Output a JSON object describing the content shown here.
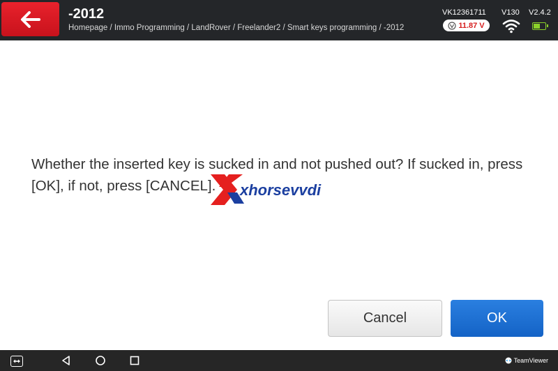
{
  "header": {
    "title": "-2012",
    "breadcrumb": "Homepage / Immo Programming / LandRover / Freelander2 / Smart keys programming / -2012",
    "serial": "VK12361711",
    "hw_version": "V130",
    "sw_version": "V2.4.2",
    "voltage": "11.87 V",
    "battery_level": 0.6,
    "icons": {
      "back": "back-arrow-icon",
      "voltage": "voltmeter-icon",
      "wifi": "wifi-icon",
      "battery": "battery-icon"
    }
  },
  "dialog": {
    "message": "Whether the inserted key is sucked in and not pushed out? If sucked in, press [OK], if not, press [CANCEL]."
  },
  "watermark": {
    "text": "xhorsevvdi"
  },
  "buttons": {
    "cancel": "Cancel",
    "ok": "OK"
  },
  "navbar": {
    "teamviewer": "TeamViewer",
    "icons": [
      "teamviewer-icon",
      "back-triangle-icon",
      "home-circle-icon",
      "recents-square-icon"
    ]
  },
  "colors": {
    "header_bg": "#242629",
    "back_btn": "#e01b24",
    "ok_btn": "#1a6fd4",
    "voltage_text": "#d61e1e",
    "battery": "#8bd12a",
    "navbar_bg": "#262626",
    "watermark_red": "#e5201f",
    "watermark_blue": "#1b3fa0"
  }
}
